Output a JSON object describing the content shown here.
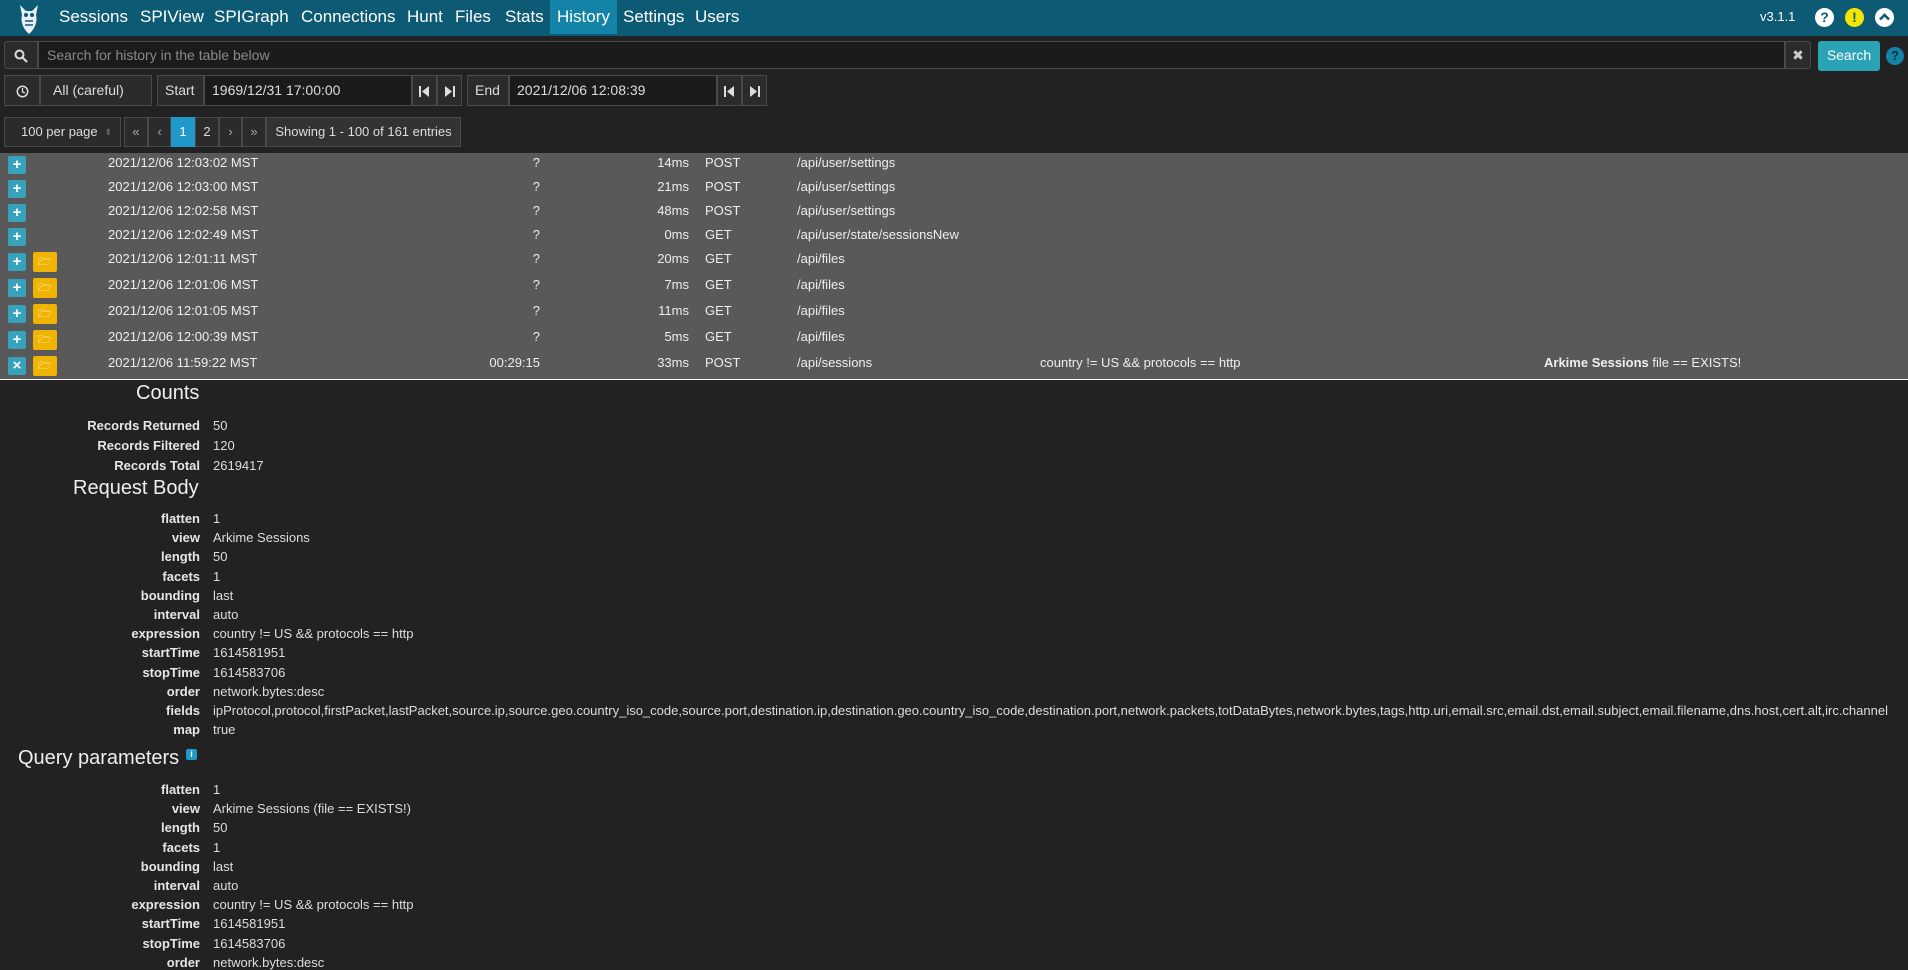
{
  "nav": {
    "items": [
      "Sessions",
      "SPIView",
      "SPIGraph",
      "Connections",
      "Hunt",
      "Files",
      "Stats",
      "History",
      "Settings",
      "Users"
    ],
    "active": "History",
    "version": "v3.1.1",
    "icons": [
      "help-icon",
      "info-icon",
      "collapse-icon"
    ],
    "colors": {
      "bar": "#0c5a74",
      "active": "#1384a8"
    }
  },
  "search": {
    "placeholder": "Search for history in the table below",
    "value": "",
    "clear_glyph": "✖",
    "button_label": "Search",
    "help_glyph": "?"
  },
  "timebar": {
    "range_label": "All (careful)",
    "start_label": "Start",
    "start_value": "1969/12/31 17:00:00",
    "end_label": "End",
    "end_value": "2021/12/06 12:08:39"
  },
  "pagination": {
    "per_page": "100 per page",
    "first": "«",
    "prev": "‹",
    "pages": [
      "1",
      "2"
    ],
    "current": "1",
    "next": "›",
    "last": "»",
    "showing": "Showing 1 - 100 of 161 entries"
  },
  "rows": [
    {
      "time": "2021/12/06 12:03:02 MST",
      "range": "?",
      "duration": "14ms",
      "method": "POST",
      "path": "/api/user/settings",
      "expression": "",
      "view": "",
      "view_rest": "",
      "has_folder": false,
      "expanded": false
    },
    {
      "time": "2021/12/06 12:03:00 MST",
      "range": "?",
      "duration": "21ms",
      "method": "POST",
      "path": "/api/user/settings",
      "expression": "",
      "view": "",
      "view_rest": "",
      "has_folder": false,
      "expanded": false
    },
    {
      "time": "2021/12/06 12:02:58 MST",
      "range": "?",
      "duration": "48ms",
      "method": "POST",
      "path": "/api/user/settings",
      "expression": "",
      "view": "",
      "view_rest": "",
      "has_folder": false,
      "expanded": false
    },
    {
      "time": "2021/12/06 12:02:49 MST",
      "range": "?",
      "duration": "0ms",
      "method": "GET",
      "path": "/api/user/state/sessionsNew",
      "expression": "",
      "view": "",
      "view_rest": "",
      "has_folder": false,
      "expanded": false
    },
    {
      "time": "2021/12/06 12:01:11 MST",
      "range": "?",
      "duration": "20ms",
      "method": "GET",
      "path": "/api/files",
      "expression": "",
      "view": "",
      "view_rest": "",
      "has_folder": true,
      "expanded": false
    },
    {
      "time": "2021/12/06 12:01:06 MST",
      "range": "?",
      "duration": "7ms",
      "method": "GET",
      "path": "/api/files",
      "expression": "",
      "view": "",
      "view_rest": "",
      "has_folder": true,
      "expanded": false
    },
    {
      "time": "2021/12/06 12:01:05 MST",
      "range": "?",
      "duration": "11ms",
      "method": "GET",
      "path": "/api/files",
      "expression": "",
      "view": "",
      "view_rest": "",
      "has_folder": true,
      "expanded": false
    },
    {
      "time": "2021/12/06 12:00:39 MST",
      "range": "?",
      "duration": "5ms",
      "method": "GET",
      "path": "/api/files",
      "expression": "",
      "view": "",
      "view_rest": "",
      "has_folder": true,
      "expanded": false
    },
    {
      "time": "2021/12/06 11:59:22 MST",
      "range": "00:29:15",
      "duration": "33ms",
      "method": "POST",
      "path": "/api/sessions",
      "expression": "country != US && protocols == http",
      "view": "Arkime Sessions",
      "view_rest": " file == EXISTS!",
      "has_folder": true,
      "expanded": true
    }
  ],
  "row_glyphs": {
    "expand": "+",
    "collapse": "×",
    "folder": "🗁"
  },
  "details": {
    "counts_title": "Counts",
    "counts": [
      {
        "key": "Records Returned",
        "value": "50"
      },
      {
        "key": "Records Filtered",
        "value": "120"
      },
      {
        "key": "Records Total",
        "value": "2619417"
      }
    ],
    "body_title": "Request Body",
    "body": [
      {
        "key": "flatten",
        "value": "1"
      },
      {
        "key": "view",
        "value": "Arkime Sessions"
      },
      {
        "key": "length",
        "value": "50"
      },
      {
        "key": "facets",
        "value": "1"
      },
      {
        "key": "bounding",
        "value": "last"
      },
      {
        "key": "interval",
        "value": "auto"
      },
      {
        "key": "expression",
        "value": "country != US && protocols == http"
      },
      {
        "key": "startTime",
        "value": "1614581951"
      },
      {
        "key": "stopTime",
        "value": "1614583706"
      },
      {
        "key": "order",
        "value": "network.bytes:desc"
      },
      {
        "key": "fields",
        "value": "ipProtocol,protocol,firstPacket,lastPacket,source.ip,source.geo.country_iso_code,source.port,destination.ip,destination.geo.country_iso_code,destination.port,network.packets,totDataBytes,network.bytes,tags,http.uri,email.src,email.dst,email.subject,email.filename,dns.host,cert.alt,irc.channel"
      },
      {
        "key": "map",
        "value": "true"
      }
    ],
    "query_title": "Query parameters",
    "query": [
      {
        "key": "flatten",
        "value": "1"
      },
      {
        "key": "view",
        "value": "Arkime Sessions  (file == EXISTS!)"
      },
      {
        "key": "length",
        "value": "50"
      },
      {
        "key": "facets",
        "value": "1"
      },
      {
        "key": "bounding",
        "value": "last"
      },
      {
        "key": "interval",
        "value": "auto"
      },
      {
        "key": "expression",
        "value": "country != US && protocols == http"
      },
      {
        "key": "startTime",
        "value": "1614581951"
      },
      {
        "key": "stopTime",
        "value": "1614583706"
      },
      {
        "key": "order",
        "value": "network.bytes:desc"
      }
    ]
  }
}
